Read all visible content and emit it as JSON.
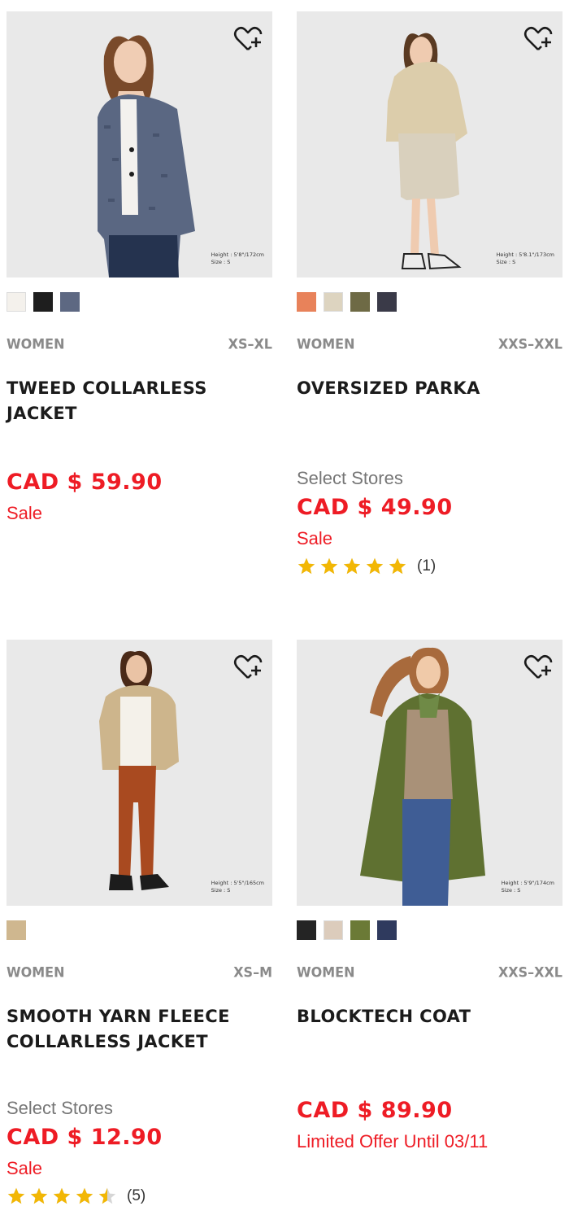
{
  "products": [
    {
      "category": "WOMEN",
      "sizes": "XS–XL",
      "name": "TWEED COLLARLESS JACKET",
      "select_stores": "",
      "price": "CAD $ 59.90",
      "flag": "Sale",
      "rating_count": "",
      "rating_value": 0,
      "model_height": "Height : 5'8\"/172cm",
      "model_size": "Size : S",
      "swatches": [
        "#f4f1ec",
        "#1e1e1e",
        "#5d6882"
      ]
    },
    {
      "category": "WOMEN",
      "sizes": "XXS–XXL",
      "name": "OVERSIZED PARKA",
      "select_stores": "Select Stores",
      "price": "CAD $ 49.90",
      "flag": "Sale",
      "rating_count": "(1)",
      "rating_value": 5,
      "model_height": "Height : 5'8.1\"/173cm",
      "model_size": "Size : S",
      "swatches": [
        "#e8825a",
        "#ddd4c0",
        "#6e6a45",
        "#3a3a48"
      ]
    },
    {
      "category": "WOMEN",
      "sizes": "XS–M",
      "name": "SMOOTH YARN FLEECE COLLARLESS JACKET",
      "select_stores": "Select Stores",
      "price": "CAD $ 12.90",
      "flag": "Sale",
      "rating_count": "(5)",
      "rating_value": 4.5,
      "model_height": "Height : 5'5\"/165cm",
      "model_size": "Size : S",
      "swatches": [
        "#cfb78f"
      ]
    },
    {
      "category": "WOMEN",
      "sizes": "XXS–XXL",
      "name": "BLOCKTECH COAT",
      "select_stores": "",
      "price": "CAD $ 89.90",
      "flag": "Limited Offer Until 03/11",
      "rating_count": "",
      "rating_value": 0,
      "model_height": "Height : 5'9\"/174cm",
      "model_size": "Size : S",
      "swatches": [
        "#242424",
        "#dcccbc",
        "#6b7a36",
        "#2f3a5e"
      ]
    }
  ],
  "colors": {
    "price_red": "#ee1c25",
    "star_gold": "#f2b705",
    "muted_gray": "#8a8a8a",
    "image_bg": "#e8e8e8"
  },
  "icons": {
    "wishlist": "heart-plus-icon",
    "rating": "star-icon"
  }
}
